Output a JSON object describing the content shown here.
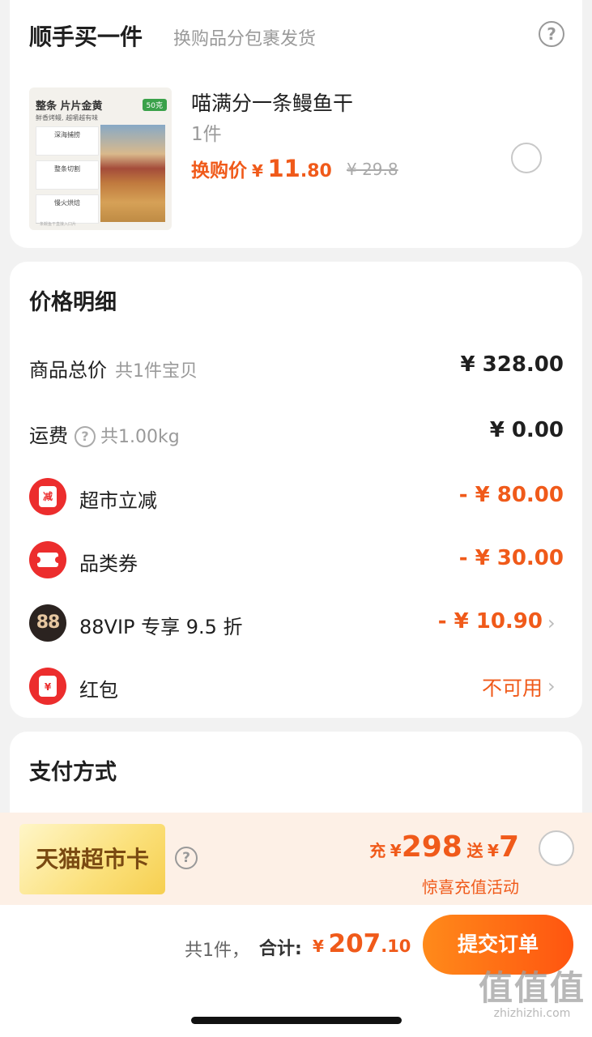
{
  "addon": {
    "title": "顺手买一件",
    "subtitle": "换购品分包裹发货",
    "help_icon": "?",
    "thumb": {
      "head": "整条 片片金黄",
      "tag": "50克",
      "sub": "鲜香烤鳗, 越嚼越有味",
      "box1": "深海捕捞",
      "box2": "整条切割",
      "box3": "慢火烘焙",
      "foot": "一条鳗鱼干直接入口片"
    },
    "product_name": "喵满分一条鳗鱼干",
    "product_qty": "1件",
    "price_label": "换购价",
    "price_yen": "¥",
    "price_int": "11",
    "price_dec": ".80",
    "orig_price": "¥ 29.8"
  },
  "price_detail": {
    "title": "价格明细",
    "rows": [
      {
        "label": "商品总价",
        "sub": "共1件宝贝",
        "value": "¥ 328.00"
      },
      {
        "label": "运费",
        "help": "?",
        "sub": "共1.00kg",
        "value": "¥ 0.00"
      },
      {
        "label": "超市立减",
        "icon": "减",
        "value": "- ¥ 80.00"
      },
      {
        "label": "品类券",
        "value": "- ¥ 30.00"
      },
      {
        "label": "88VIP 专享 9.5 折",
        "icon": "88",
        "value": "- ¥ 10.90",
        "chevron": "›"
      },
      {
        "label": "红包",
        "icon": "¥",
        "value": "不可用",
        "chevron": "›"
      }
    ]
  },
  "payment": {
    "title": "支付方式"
  },
  "recharge": {
    "card_label": "天猫超市卡",
    "help_icon": "?",
    "prefix": "充",
    "yen1": "¥",
    "amount": "298",
    "gift_word": "送",
    "yen2": "¥",
    "gift": "7",
    "note": "惊喜充值活动"
  },
  "bottom": {
    "count": "共1件，",
    "total_label": "合计:",
    "yen": "¥",
    "total_int": "207",
    "total_dec": ".10",
    "submit": "提交订单"
  },
  "watermark": {
    "big": "值值值",
    "small": "zhizhizhi.com"
  },
  "colors": {
    "accent": "#f05a1a",
    "icon_red": "#ec2d2d",
    "vip_dark": "#2b2320",
    "page_bg": "#f2f2f2",
    "recharge_bg": "#fdf0e6"
  }
}
